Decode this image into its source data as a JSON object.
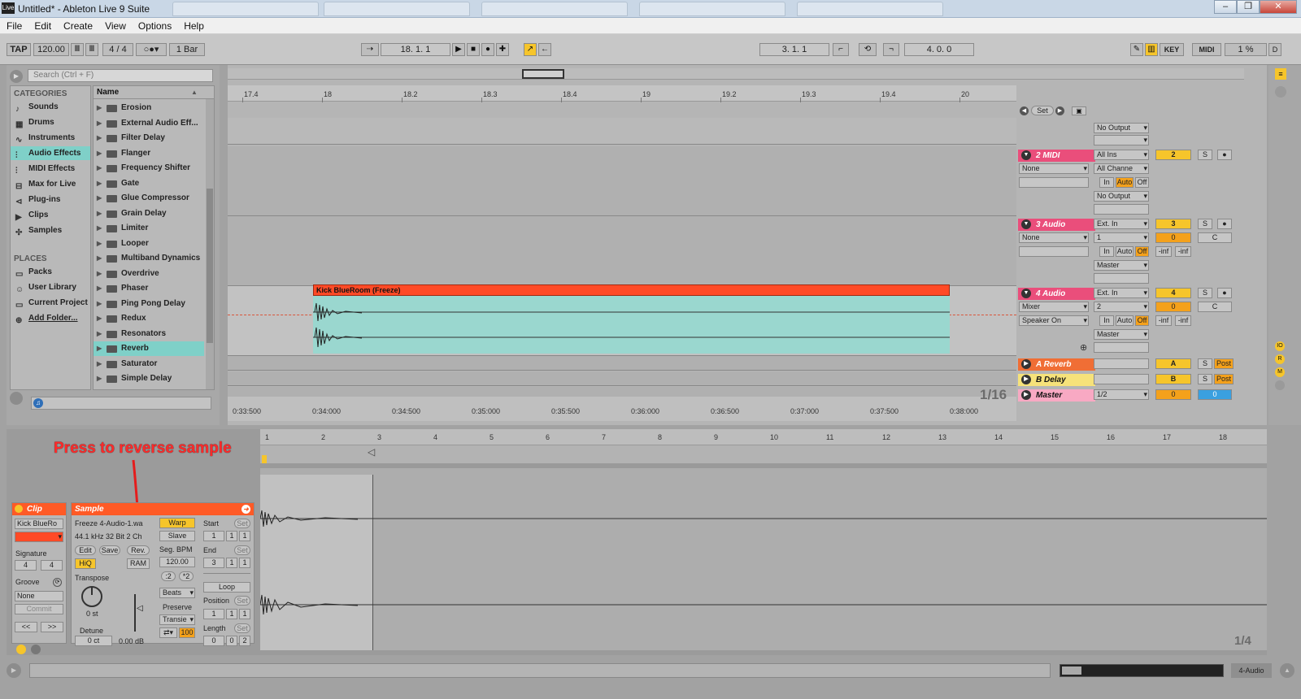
{
  "window": {
    "title": "Untitled* - Ableton Live 9 Suite",
    "min": "‒",
    "max": "❐",
    "close": "✕"
  },
  "menu": [
    "File",
    "Edit",
    "Create",
    "View",
    "Options",
    "Help"
  ],
  "transport": {
    "tap": "TAP",
    "tempo": "120.00",
    "sig": "4 / 4",
    "quant": "1 Bar",
    "pos": "18.   1.   1",
    "loop_start": "3.   1.   1",
    "loop_len": "4.   0.   0",
    "key": "KEY",
    "midi": "MIDI",
    "cpu": "1 %",
    "d": "D"
  },
  "browser": {
    "search_placeholder": "Search (Ctrl + F)",
    "categories_title": "CATEGORIES",
    "places_title": "PLACES",
    "name_header": "Name",
    "categories": [
      {
        "label": "Sounds",
        "icon": "♪"
      },
      {
        "label": "Drums",
        "icon": "▦"
      },
      {
        "label": "Instruments",
        "icon": "∿"
      },
      {
        "label": "Audio Effects",
        "icon": "⫶"
      },
      {
        "label": "MIDI Effects",
        "icon": "⫶"
      },
      {
        "label": "Max for Live",
        "icon": "⊟"
      },
      {
        "label": "Plug-ins",
        "icon": "⊲"
      },
      {
        "label": "Clips",
        "icon": "▶"
      },
      {
        "label": "Samples",
        "icon": "✣"
      }
    ],
    "places": [
      {
        "label": "Packs",
        "icon": "▭"
      },
      {
        "label": "User Library",
        "icon": "☺"
      },
      {
        "label": "Current Project",
        "icon": "▭"
      },
      {
        "label": "Add Folder...",
        "icon": "⊕"
      }
    ],
    "items": [
      "Erosion",
      "External Audio Eff...",
      "Filter Delay",
      "Flanger",
      "Frequency Shifter",
      "Gate",
      "Glue Compressor",
      "Grain Delay",
      "Limiter",
      "Looper",
      "Multiband Dynamics",
      "Overdrive",
      "Phaser",
      "Ping Pong Delay",
      "Redux",
      "Resonators",
      "Reverb",
      "Saturator",
      "Simple Delay"
    ]
  },
  "arrangement": {
    "ruler": [
      "17.4",
      "18",
      "18.2",
      "18.3",
      "18.4",
      "19",
      "19.2",
      "19.3",
      "19.4",
      "20"
    ],
    "times": [
      "0:33:500",
      "0:34:000",
      "0:34:500",
      "0:35:000",
      "0:35:500",
      "0:36:000",
      "0:36:500",
      "0:37:000",
      "0:37:500",
      "0:38:000"
    ],
    "clip_name": "Kick BlueRoom (Freeze)",
    "grid": "1/16",
    "set": "Set"
  },
  "mixer": {
    "tracks": [
      {
        "name": "2 MIDI",
        "color": "#ea4e7b",
        "in": "All Ins",
        "chan": "All Channe",
        "out": "No Output",
        "num": "2",
        "dev": "None"
      },
      {
        "name": "3 Audio",
        "color": "#ea4e7b",
        "in": "Ext. In",
        "chan": "1",
        "out": "Master",
        "num": "3",
        "dev": "None",
        "vol": "0",
        "pan": "C"
      },
      {
        "name": "4 Audio",
        "color": "#ea4e7b",
        "in": "Ext. In",
        "chan": "2",
        "out": "Master",
        "num": "4",
        "dev": "Mixer",
        "dev2": "Speaker On",
        "vol": "0",
        "pan": "C"
      }
    ],
    "returns": [
      {
        "name": "A Reverb",
        "color": "#f06e35",
        "num": "A"
      },
      {
        "name": "B Delay",
        "color": "#f6e27a",
        "num": "B"
      }
    ],
    "master": {
      "name": "Master",
      "color": "#f8a9c3",
      "out": "1/2",
      "vol": "0",
      "vol2": "0"
    },
    "prev_out": "No Output",
    "in_lbl": "In",
    "auto_lbl": "Auto",
    "off_lbl": "Off",
    "s_lbl": "S",
    "post": "Post",
    "inf": "-inf"
  },
  "detail": {
    "annotation": "Press to reverse sample",
    "clip": {
      "title": "Clip",
      "name": "Kick BlueRo",
      "signature": "Signature",
      "sig_num": "4",
      "sig_den": "4",
      "groove": "Groove",
      "groove_val": "None",
      "commit": "Commit"
    },
    "sample": {
      "title": "Sample",
      "file": "Freeze 4-Audio-1.wa",
      "info": "44.1 kHz 32 Bit 2 Ch",
      "edit": "Edit",
      "save": "Save",
      "rev": "Rev.",
      "hiq": "HiQ",
      "ram": "RAM",
      "transpose": "Transpose",
      "st": "0 st",
      "detune": "Detune",
      "ct": "0 ct",
      "gain": "0.00 dB",
      "warp": "Warp",
      "slave": "Slave",
      "segbpm": "Seg. BPM",
      "bpm": "120.00",
      "half": ":2",
      "dbl": "*2",
      "beats": "Beats",
      "preserve": "Preserve",
      "transients": "Transie",
      "pct": "100",
      "start": "Start",
      "end": "End",
      "loop": "Loop",
      "position": "Position",
      "length": "Length",
      "set": "Set",
      "start_vals": [
        "1",
        "1",
        "1"
      ],
      "end_vals": [
        "3",
        "1",
        "1"
      ],
      "pos_vals": [
        "1",
        "1",
        "1"
      ],
      "len_vals": [
        "0",
        "0",
        "2"
      ]
    },
    "ruler": [
      "1",
      "2",
      "3",
      "4",
      "5",
      "6",
      "7",
      "8",
      "9",
      "10",
      "11",
      "12",
      "13",
      "14",
      "15",
      "16",
      "17",
      "18"
    ],
    "zoom": "1/4"
  },
  "status": {
    "track": "4-Audio"
  }
}
